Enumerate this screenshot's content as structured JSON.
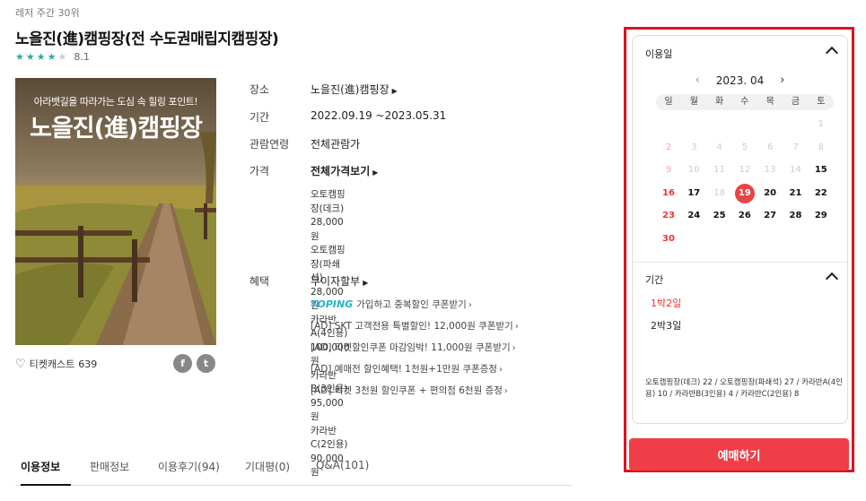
{
  "rank": "레저 주간 30위",
  "title": "노을진(進)캠핑장(전 수도권매립지캠핑장)",
  "rating": {
    "score": "8.1",
    "stars": 4
  },
  "poster": {
    "subtitle": "아라뱃길을 따라가는 도심 속 힐링 포인트!",
    "headline": "노을진(進)캠핑장"
  },
  "cast": {
    "label": "티켓캐스트",
    "count": "639"
  },
  "share": {
    "facebook": "f",
    "twitter": "t"
  },
  "info": {
    "place_label": "장소",
    "place_value": "노을진(進)캠핑장",
    "period_label": "기간",
    "period_value": "2022.09.19 ~2023.05.31",
    "age_label": "관람연령",
    "age_value": "전체관람가",
    "price_label": "가격",
    "price_value": "전체가격보기",
    "prices": [
      "오토캠핑장(데크) 28,000원",
      "오토캠핑장(파쇄석) 28,000원",
      "카라반A(4인용) 100,000원",
      "카라반B(3인용) 95,000원",
      "카라반C(2인용) 90,000원"
    ],
    "benefit_label": "혜택",
    "benefit_value": "무이자할부",
    "toping": "TOPING",
    "benefits": [
      "가입하고 중복할인 쿠폰받기",
      "[AD] SKT 고객전용 특별할인! 12,000원 쿠폰받기",
      "[AD] 티켓할인쿠폰 마감임박! 11,000원 쿠폰받기",
      "[AD] 예매전 할인혜택! 1천원+1만원 쿠폰증정",
      "[AD] 티켓 3천원 할인쿠폰 + 편의점 6천원 증정"
    ]
  },
  "tabs": [
    "이용정보",
    "판매정보",
    "이용후기(94)",
    "기대평(0)",
    "Q&A(101)"
  ],
  "booking": {
    "date_label": "이용일",
    "month": "2023. 04",
    "weekdays": [
      "일",
      "월",
      "화",
      "수",
      "목",
      "금",
      "토"
    ],
    "days": [
      [
        "",
        "",
        "",
        "",
        "",
        "",
        "1"
      ],
      [
        "2",
        "3",
        "4",
        "5",
        "6",
        "7",
        "8"
      ],
      [
        "9",
        "10",
        "11",
        "12",
        "13",
        "14",
        "15"
      ],
      [
        "16",
        "17",
        "18",
        "19",
        "20",
        "21",
        "22"
      ],
      [
        "23",
        "24",
        "25",
        "26",
        "27",
        "28",
        "29"
      ],
      [
        "30",
        "",
        "",
        "",
        "",
        "",
        ""
      ]
    ],
    "selected_day": "19",
    "period_label": "기간",
    "periods": [
      "1박2일",
      "2박3일"
    ],
    "summary": "오토캠핑장(데크) 22 / 오토캠핑장(파쇄석) 27 / 카라반A(4인용) 10 / 카라반B(3인용) 4 / 카라반C(2인용) 8",
    "book_button": "예매하기"
  },
  "colors": {
    "accent": "#ef3e47",
    "highlight_border": "#e0111f",
    "star": "#32a7a7"
  }
}
